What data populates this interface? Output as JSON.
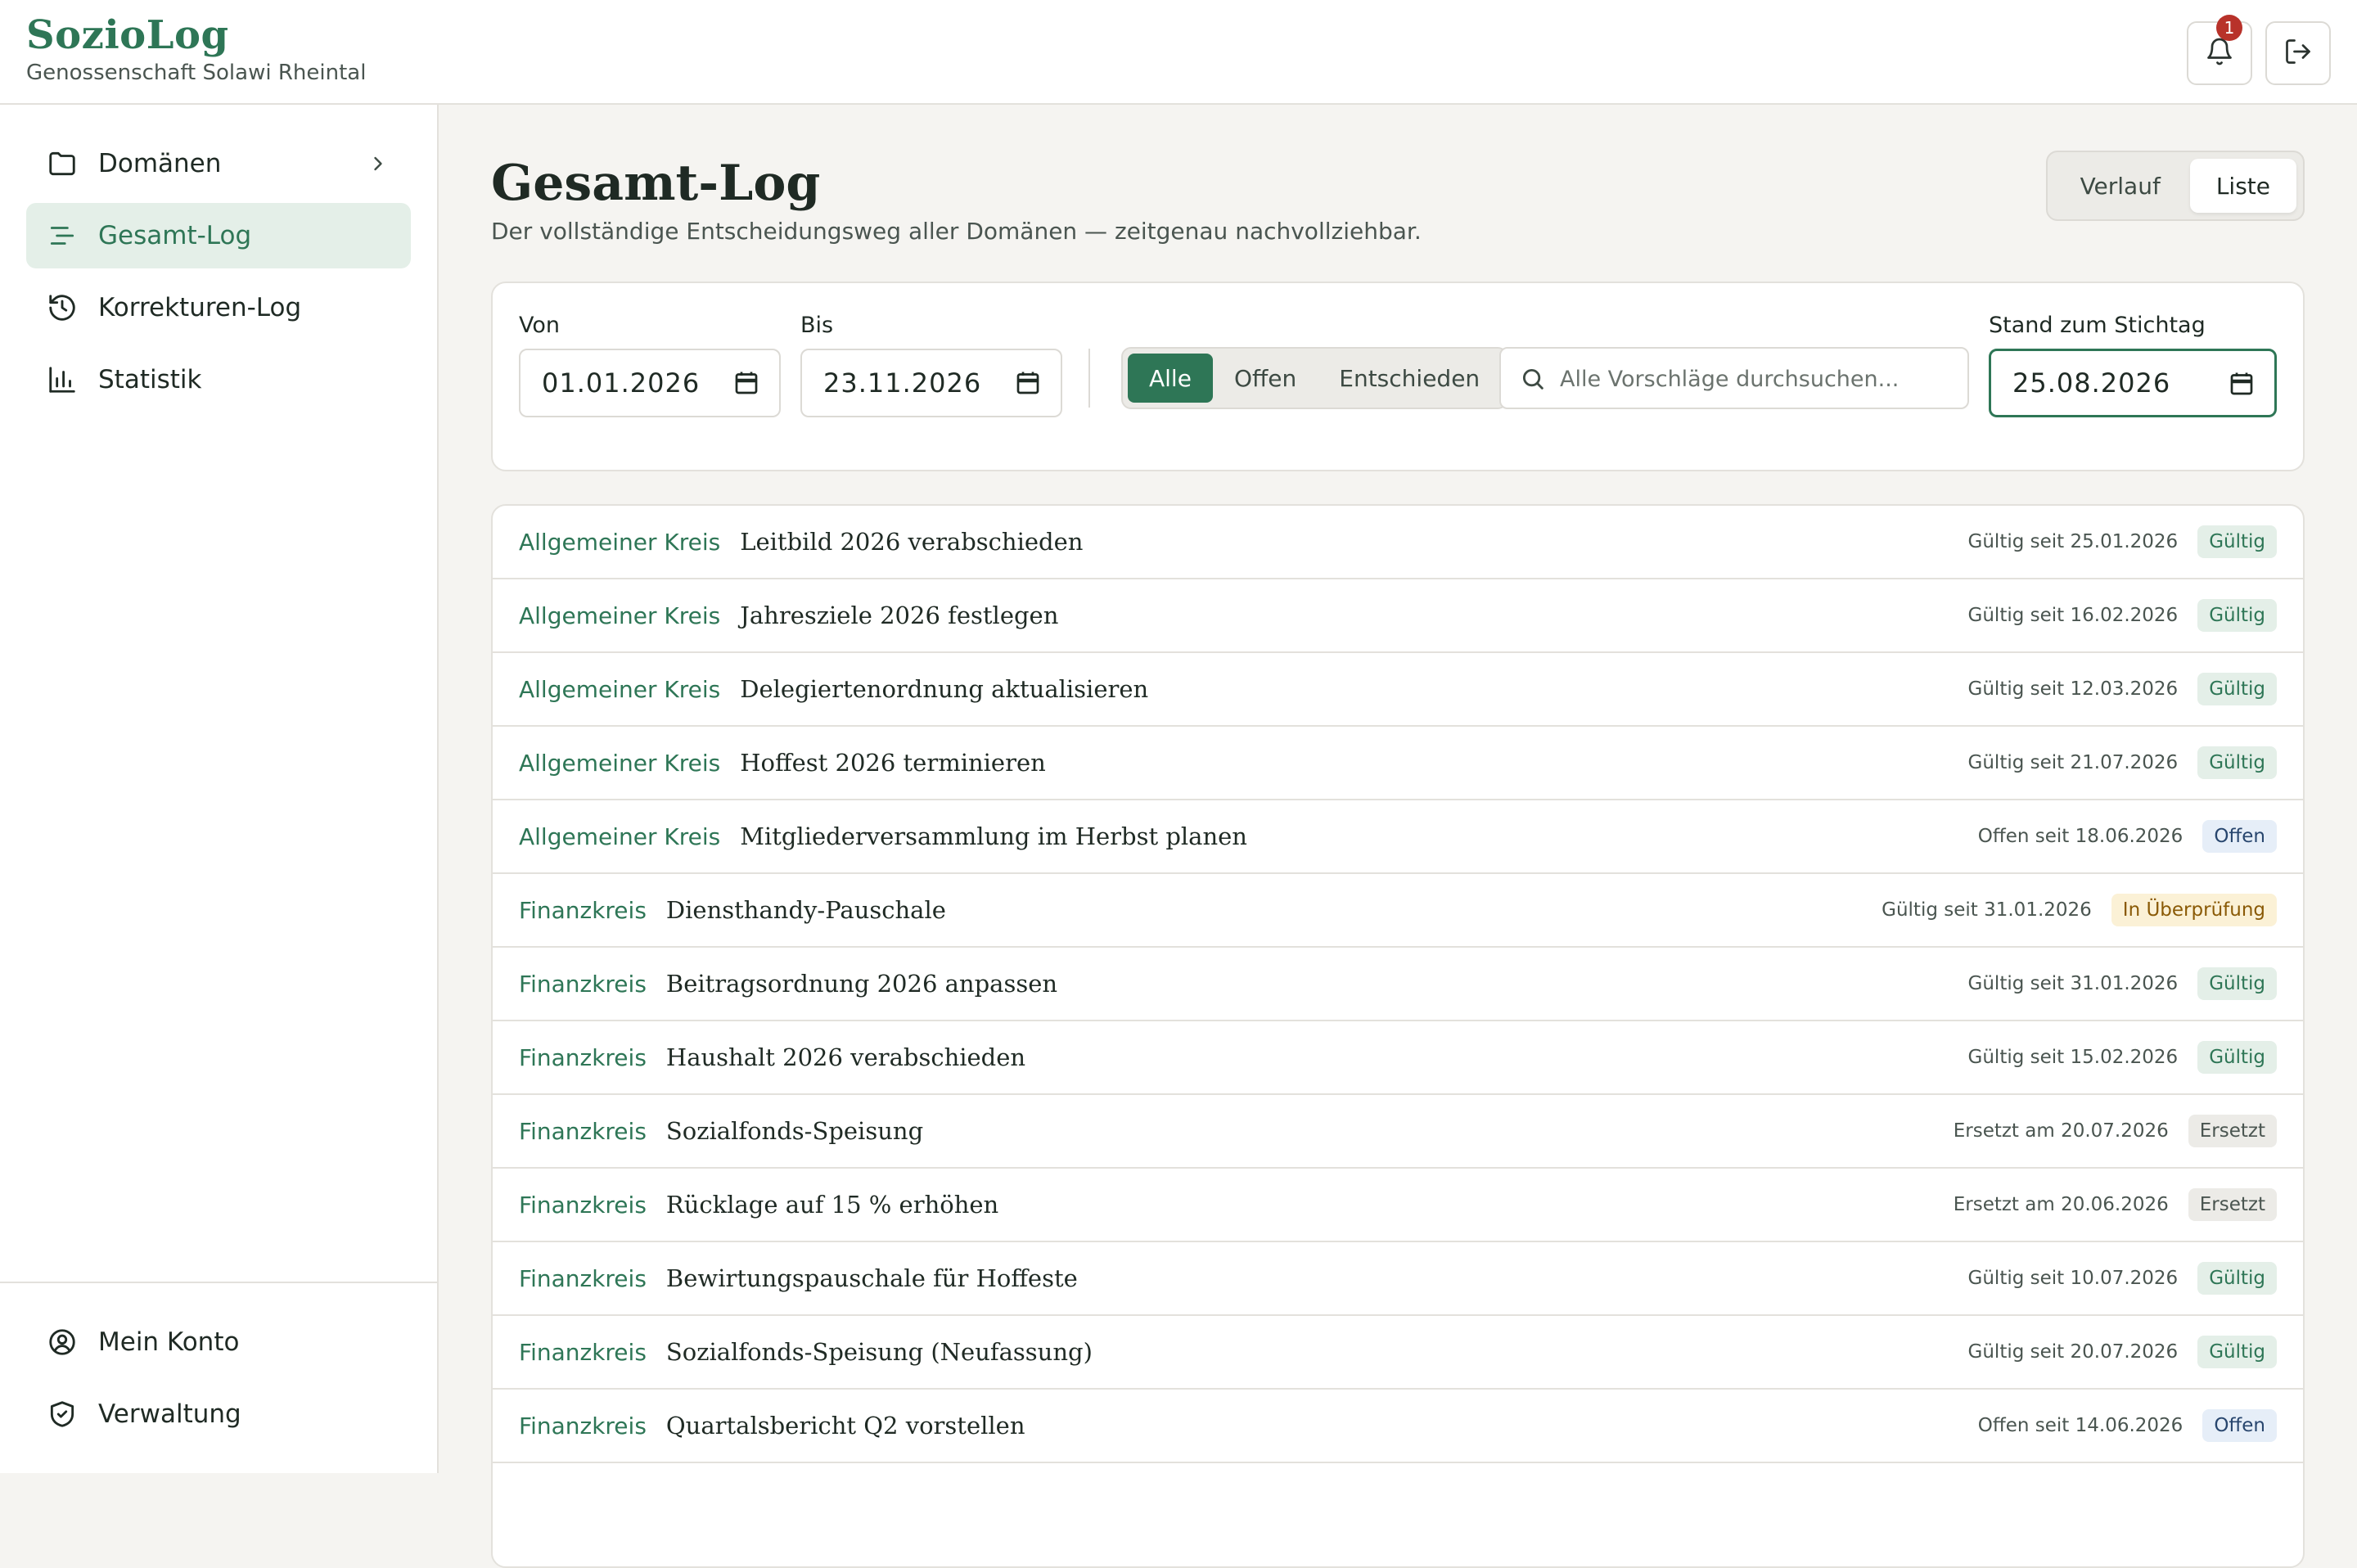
{
  "brand": {
    "title": "SozioLog",
    "subtitle": "Genossenschaft Solawi Rheintal"
  },
  "header": {
    "notification_count": "1"
  },
  "sidebar": {
    "items": [
      {
        "label": "Domänen",
        "icon": "folder-icon",
        "active": false
      },
      {
        "label": "Gesamt-Log",
        "icon": "list-icon",
        "active": true
      },
      {
        "label": "Korrekturen-Log",
        "icon": "history-icon",
        "active": false
      },
      {
        "label": "Statistik",
        "icon": "bar-chart-icon",
        "active": false
      }
    ],
    "bottom": [
      {
        "label": "Mein Konto",
        "icon": "user-circle-icon"
      },
      {
        "label": "Verwaltung",
        "icon": "shield-check-icon"
      }
    ]
  },
  "page": {
    "title": "Gesamt-Log",
    "subtitle": "Der vollständige Entscheidungsweg aller Domänen — zeitgenau nachvollziehbar.",
    "view_toggle": {
      "options": [
        "Verlauf",
        "Liste"
      ],
      "selected": "Liste"
    }
  },
  "filters": {
    "from_label": "Von",
    "from_value": "01.01.2026",
    "to_label": "Bis",
    "to_value": "23.11.2026",
    "status_options": [
      "Alle",
      "Offen",
      "Entschieden"
    ],
    "status_selected": "Alle",
    "search_placeholder": "Alle Vorschläge durchsuchen...",
    "cutoff_label": "Stand zum Stichtag",
    "cutoff_value": "25.08.2026"
  },
  "colors": {
    "accent": "#2e7656",
    "background": "#f5f4f1",
    "badge_alert": "#b8322a"
  },
  "entries": [
    {
      "domain": "Allgemeiner Kreis",
      "title": "Leitbild 2026 verabschieden",
      "meta": "Gültig seit 25.01.2026",
      "status": "Gültig",
      "tone": "green"
    },
    {
      "domain": "Allgemeiner Kreis",
      "title": "Jahresziele 2026 festlegen",
      "meta": "Gültig seit 16.02.2026",
      "status": "Gültig",
      "tone": "green"
    },
    {
      "domain": "Allgemeiner Kreis",
      "title": "Delegiertenordnung aktualisieren",
      "meta": "Gültig seit 12.03.2026",
      "status": "Gültig",
      "tone": "green"
    },
    {
      "domain": "Allgemeiner Kreis",
      "title": "Hoffest 2026 terminieren",
      "meta": "Gültig seit 21.07.2026",
      "status": "Gültig",
      "tone": "green"
    },
    {
      "domain": "Allgemeiner Kreis",
      "title": "Mitgliederversammlung im Herbst planen",
      "meta": "Offen seit 18.06.2026",
      "status": "Offen",
      "tone": "blue"
    },
    {
      "domain": "Finanzkreis",
      "title": "Diensthandy-Pauschale",
      "meta": "Gültig seit 31.01.2026",
      "status": "In Überprüfung",
      "tone": "yellow"
    },
    {
      "domain": "Finanzkreis",
      "title": "Beitragsordnung 2026 anpassen",
      "meta": "Gültig seit 31.01.2026",
      "status": "Gültig",
      "tone": "green"
    },
    {
      "domain": "Finanzkreis",
      "title": "Haushalt 2026 verabschieden",
      "meta": "Gültig seit 15.02.2026",
      "status": "Gültig",
      "tone": "green"
    },
    {
      "domain": "Finanzkreis",
      "title": "Sozialfonds-Speisung",
      "meta": "Ersetzt am 20.07.2026",
      "status": "Ersetzt",
      "tone": "gray"
    },
    {
      "domain": "Finanzkreis",
      "title": "Rücklage auf 15 % erhöhen",
      "meta": "Ersetzt am 20.06.2026",
      "status": "Ersetzt",
      "tone": "gray"
    },
    {
      "domain": "Finanzkreis",
      "title": "Bewirtungspauschale für Hoffeste",
      "meta": "Gültig seit 10.07.2026",
      "status": "Gültig",
      "tone": "green"
    },
    {
      "domain": "Finanzkreis",
      "title": "Sozialfonds-Speisung (Neufassung)",
      "meta": "Gültig seit 20.07.2026",
      "status": "Gültig",
      "tone": "green"
    },
    {
      "domain": "Finanzkreis",
      "title": "Quartalsbericht Q2 vorstellen",
      "meta": "Offen seit 14.06.2026",
      "status": "Offen",
      "tone": "blue"
    }
  ]
}
